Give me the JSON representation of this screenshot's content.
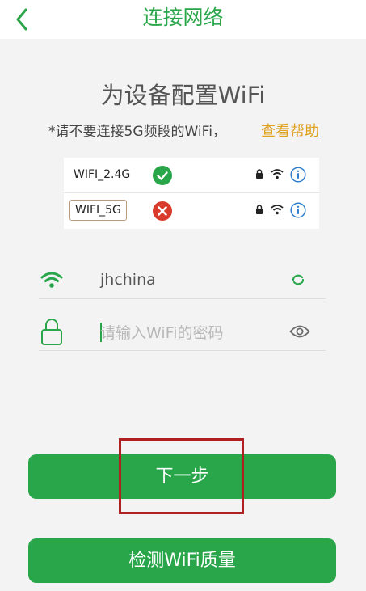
{
  "header": {
    "title": "连接网络",
    "back_icon": "chevron-left-icon"
  },
  "main": {
    "title": "为设备配置WiFi",
    "subtitle": "*请不要连接5G频段的WiFi，",
    "help_link": "查看帮助"
  },
  "wifi_list": [
    {
      "ssid": "WIFI_2.4G",
      "status": "ok",
      "status_icon": "check-circle-icon",
      "status_color": "#2aa64a"
    },
    {
      "ssid": "WIFI_5G",
      "status": "error",
      "status_icon": "x-circle-icon",
      "status_color": "#d93a2b"
    }
  ],
  "form": {
    "ssid_value": "jhchina",
    "password_placeholder": "请输入WiFi的密码"
  },
  "buttons": {
    "next_label": "下一步",
    "check_label": "检测WiFi质量"
  },
  "colors": {
    "accent": "#2aa64a",
    "link": "#e0a020",
    "highlight": "#b02020"
  }
}
